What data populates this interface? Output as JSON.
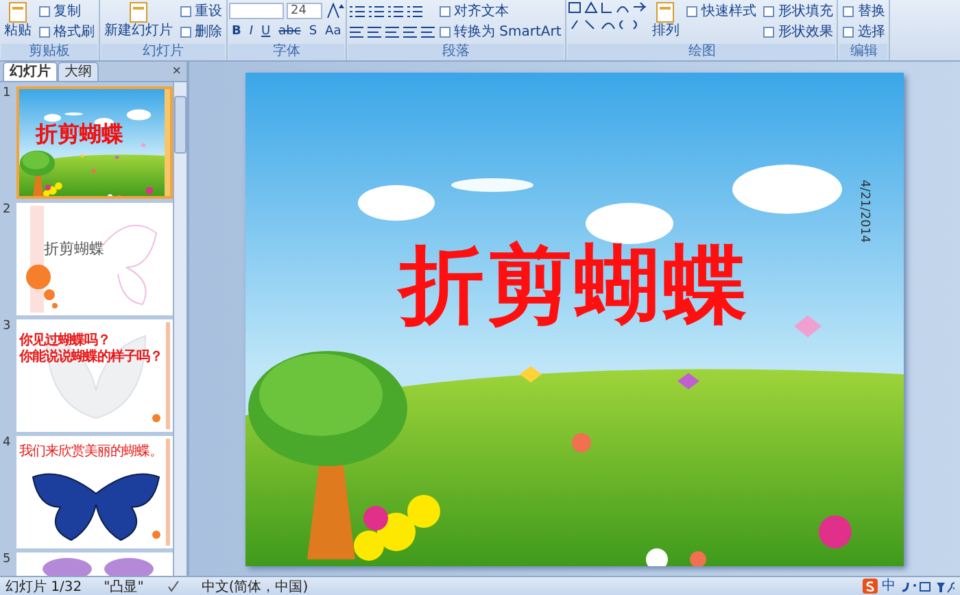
{
  "ribbon": {
    "groups": [
      {
        "label": "剪贴板",
        "columns": [
          [
            {
              "kind": "big",
              "label": "粘贴"
            }
          ],
          [
            {
              "kind": "small",
              "label": "复制"
            },
            {
              "kind": "small",
              "label": "格式刷"
            }
          ]
        ]
      },
      {
        "label": "幻灯片",
        "columns": [
          [
            {
              "kind": "big",
              "label": "新建幻灯片"
            }
          ],
          [
            {
              "kind": "small",
              "label": "重设"
            },
            {
              "kind": "small",
              "label": "删除"
            }
          ]
        ]
      },
      {
        "label": "字体",
        "columns": [
          [
            {
              "kind": "fields",
              "values": [
                "24"
              ]
            },
            {
              "kind": "glyphs",
              "values": [
                "B",
                "I",
                "U",
                "abc",
                "S",
                "Aa"
              ]
            }
          ]
        ]
      },
      {
        "label": "段落",
        "columns": [
          [
            {
              "kind": "listicons"
            },
            {
              "kind": "aligns"
            }
          ],
          [
            {
              "kind": "small",
              "label": "对齐文本"
            },
            {
              "kind": "small",
              "label": "转换为 SmartArt"
            }
          ]
        ]
      },
      {
        "label": "绘图",
        "columns": [
          [
            {
              "kind": "shapes"
            }
          ],
          [
            {
              "kind": "big",
              "label": "排列"
            }
          ],
          [
            {
              "kind": "small",
              "label": "快速样式"
            }
          ],
          [
            {
              "kind": "small",
              "label": "形状填充"
            },
            {
              "kind": "small",
              "label": "形状效果"
            }
          ]
        ]
      },
      {
        "label": "编辑",
        "columns": [
          [
            {
              "kind": "small",
              "label": "替换"
            },
            {
              "kind": "small",
              "label": "选择"
            }
          ]
        ]
      }
    ]
  },
  "panel": {
    "tabs": [
      {
        "label": "幻灯片",
        "selected": true
      },
      {
        "label": "大纲",
        "selected": false
      }
    ],
    "close": "×",
    "slides": [
      {
        "number": "1",
        "kind": "scene",
        "selected": true,
        "lines": [
          "折剪蝴蝶"
        ]
      },
      {
        "number": "2",
        "kind": "circles",
        "selected": false,
        "lines": [
          "折剪蝴蝶"
        ]
      },
      {
        "number": "3",
        "kind": "question",
        "selected": false,
        "lines": [
          "你见过蝴蝶吗？",
          "你能说说蝴蝶的样子吗？"
        ]
      },
      {
        "number": "4",
        "kind": "butterfly",
        "selected": false,
        "lines": [
          "我们来欣赏美丽的蝴蝶。"
        ]
      },
      {
        "number": "5",
        "kind": "partial",
        "selected": false
      }
    ]
  },
  "slide": {
    "title": "折剪蝴蝶",
    "date": "4/21/2014"
  },
  "status_bar": {
    "slide": "幻灯片 1/32",
    "theme": "\"凸显\"",
    "language": "中文(简体，中国)",
    "ime": "中"
  }
}
